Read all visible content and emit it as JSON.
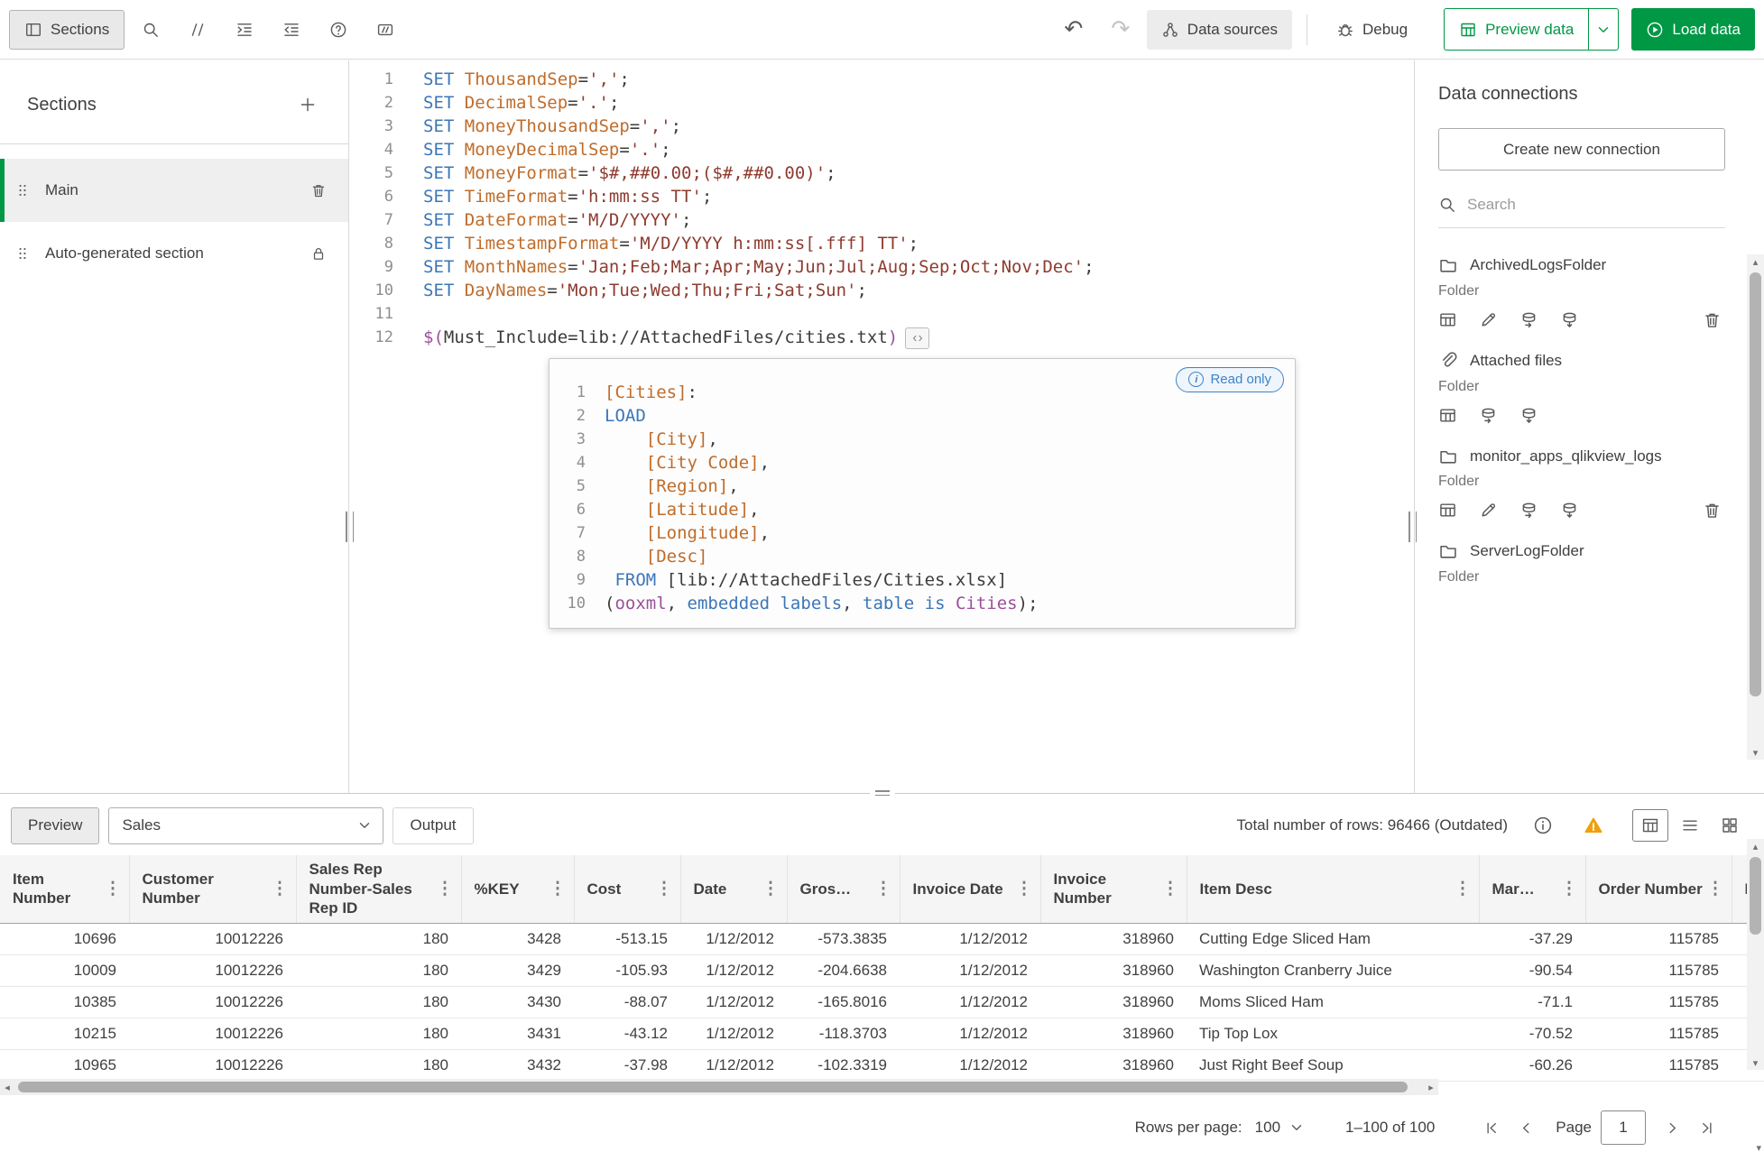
{
  "colors": {
    "accent_green": "#009845",
    "keyword_blue": "#3b76b8",
    "name_orange": "#bf6c2a",
    "string_red": "#8e3b2f",
    "operator_purple": "#9b4f9b",
    "warning_orange": "#efa00b",
    "readonly_blue": "#3e83c6"
  },
  "icons": {
    "undo": "↶",
    "redo": "↷",
    "kebab": "⋮",
    "scroll_up": "▴",
    "scroll_down": "▾",
    "scroll_left": "◂",
    "scroll_right": "▸"
  },
  "toolbar": {
    "sections_label": "Sections",
    "data_sources_label": "Data sources",
    "debug_label": "Debug",
    "preview_data_label": "Preview data",
    "load_data_label": "Load data"
  },
  "sidebar": {
    "title": "Sections",
    "items": [
      {
        "label": "Main",
        "selected": true,
        "locked": false
      },
      {
        "label": "Auto-generated section",
        "selected": false,
        "locked": true
      }
    ]
  },
  "editor": {
    "read_only_label": "Read only",
    "lines": [
      [
        [
          "SET ",
          "k"
        ],
        [
          "ThousandSep",
          "n"
        ],
        [
          "=",
          "p"
        ],
        [
          "','",
          "s"
        ],
        [
          ";",
          "p"
        ]
      ],
      [
        [
          "SET ",
          "k"
        ],
        [
          "DecimalSep",
          "n"
        ],
        [
          "=",
          "p"
        ],
        [
          "'.'",
          "s"
        ],
        [
          ";",
          "p"
        ]
      ],
      [
        [
          "SET ",
          "k"
        ],
        [
          "MoneyThousandSep",
          "n"
        ],
        [
          "=",
          "p"
        ],
        [
          "','",
          "s"
        ],
        [
          ";",
          "p"
        ]
      ],
      [
        [
          "SET ",
          "k"
        ],
        [
          "MoneyDecimalSep",
          "n"
        ],
        [
          "=",
          "p"
        ],
        [
          "'.'",
          "s"
        ],
        [
          ";",
          "p"
        ]
      ],
      [
        [
          "SET ",
          "k"
        ],
        [
          "MoneyFormat",
          "n"
        ],
        [
          "=",
          "p"
        ],
        [
          "'$#,##0.00;($#,##0.00)'",
          "s"
        ],
        [
          ";",
          "p"
        ]
      ],
      [
        [
          "SET ",
          "k"
        ],
        [
          "TimeFormat",
          "n"
        ],
        [
          "=",
          "p"
        ],
        [
          "'h:mm:ss TT'",
          "s"
        ],
        [
          ";",
          "p"
        ]
      ],
      [
        [
          "SET ",
          "k"
        ],
        [
          "DateFormat",
          "n"
        ],
        [
          "=",
          "p"
        ],
        [
          "'M/D/YYYY'",
          "s"
        ],
        [
          ";",
          "p"
        ]
      ],
      [
        [
          "SET ",
          "k"
        ],
        [
          "TimestampFormat",
          "n"
        ],
        [
          "=",
          "p"
        ],
        [
          "'M/D/YYYY h:mm:ss[.fff] TT'",
          "s"
        ],
        [
          ";",
          "p"
        ]
      ],
      [
        [
          "SET ",
          "k"
        ],
        [
          "MonthNames",
          "n"
        ],
        [
          "=",
          "p"
        ],
        [
          "'Jan;Feb;Mar;Apr;May;Jun;Jul;Aug;Sep;Oct;Nov;Dec'",
          "s"
        ],
        [
          ";",
          "p"
        ]
      ],
      [
        [
          "SET ",
          "k"
        ],
        [
          "DayNames",
          "n"
        ],
        [
          "=",
          "p"
        ],
        [
          "'Mon;Tue;Wed;Thu;Fri;Sat;Sun'",
          "s"
        ],
        [
          ";",
          "p"
        ]
      ],
      [],
      [
        [
          "$(",
          "m"
        ],
        [
          "Must_Include=lib://AttachedFiles/cities.txt",
          "p"
        ],
        [
          ")",
          "m"
        ]
      ]
    ],
    "embedded_lines": [
      [
        [
          "[Cities]",
          "n"
        ],
        [
          ":",
          "p"
        ]
      ],
      [
        [
          "LOAD",
          "k"
        ]
      ],
      [
        [
          "    ",
          "p"
        ],
        [
          "[City]",
          "n"
        ],
        [
          ",",
          "p"
        ]
      ],
      [
        [
          "    ",
          "p"
        ],
        [
          "[City Code]",
          "n"
        ],
        [
          ",",
          "p"
        ]
      ],
      [
        [
          "    ",
          "p"
        ],
        [
          "[Region]",
          "n"
        ],
        [
          ",",
          "p"
        ]
      ],
      [
        [
          "    ",
          "p"
        ],
        [
          "[Latitude]",
          "n"
        ],
        [
          ",",
          "p"
        ]
      ],
      [
        [
          "    ",
          "p"
        ],
        [
          "[Longitude]",
          "n"
        ],
        [
          ",",
          "p"
        ]
      ],
      [
        [
          "    ",
          "p"
        ],
        [
          "[Desc]",
          "n"
        ]
      ],
      [
        [
          " FROM ",
          "k"
        ],
        [
          "[lib://AttachedFiles/Cities.xlsx]",
          "p"
        ]
      ],
      [
        [
          "(",
          "p"
        ],
        [
          "ooxml",
          "m"
        ],
        [
          ", ",
          "p"
        ],
        [
          "embedded labels",
          "k"
        ],
        [
          ", ",
          "p"
        ],
        [
          "table is ",
          "k"
        ],
        [
          "Cities",
          "m"
        ],
        [
          ");",
          "p"
        ]
      ]
    ]
  },
  "connections": {
    "title": "Data connections",
    "create_button": "Create new connection",
    "search_placeholder": "Search",
    "items": [
      {
        "name": "ArchivedLogsFolder",
        "type": "Folder",
        "icon": "folder",
        "actions": [
          "select-data",
          "edit",
          "sync",
          "load",
          "delete"
        ]
      },
      {
        "name": "Attached files",
        "type": "Folder",
        "icon": "paperclip",
        "actions": [
          "select-data",
          "sync",
          "load"
        ]
      },
      {
        "name": "monitor_apps_qlikview_logs",
        "type": "Folder",
        "icon": "folder",
        "actions": [
          "select-data",
          "edit",
          "sync",
          "load",
          "delete"
        ]
      },
      {
        "name": "ServerLogFolder",
        "type": "Folder",
        "icon": "folder",
        "actions": []
      }
    ]
  },
  "preview": {
    "preview_button": "Preview",
    "table_select_value": "Sales",
    "output_button": "Output",
    "total_rows_text": "Total number of rows: 96466 (Outdated)",
    "columns": [
      "Item Number",
      "Customer Number",
      "Sales Rep Number-Sales Rep ID",
      "%KEY",
      "Cost",
      "Date",
      "Gros…",
      "Invoice Date",
      "Invoice Number",
      "Item Desc",
      "Mar…",
      "Order Number",
      "P"
    ],
    "rows": [
      [
        "10696",
        "10012226",
        "180",
        "3428",
        "-513.15",
        "1/12/2012",
        "-573.3835",
        "1/12/2012",
        "318960",
        "Cutting Edge Sliced Ham",
        "-37.29",
        "115785",
        ""
      ],
      [
        "10009",
        "10012226",
        "180",
        "3429",
        "-105.93",
        "1/12/2012",
        "-204.6638",
        "1/12/2012",
        "318960",
        "Washington Cranberry Juice",
        "-90.54",
        "115785",
        ""
      ],
      [
        "10385",
        "10012226",
        "180",
        "3430",
        "-88.07",
        "1/12/2012",
        "-165.8016",
        "1/12/2012",
        "318960",
        "Moms Sliced Ham",
        "-71.1",
        "115785",
        ""
      ],
      [
        "10215",
        "10012226",
        "180",
        "3431",
        "-43.12",
        "1/12/2012",
        "-118.3703",
        "1/12/2012",
        "318960",
        "Tip Top Lox",
        "-70.52",
        "115785",
        ""
      ],
      [
        "10965",
        "10012226",
        "180",
        "3432",
        "-37.98",
        "1/12/2012",
        "-102.3319",
        "1/12/2012",
        "318960",
        "Just Right Beef Soup",
        "-60.26",
        "115785",
        ""
      ]
    ],
    "pagination": {
      "rows_label": "Rows per page:",
      "rows_per_page_value": "100",
      "range_text": "1–100 of 100",
      "page_label": "Page",
      "page_value": "1"
    }
  }
}
